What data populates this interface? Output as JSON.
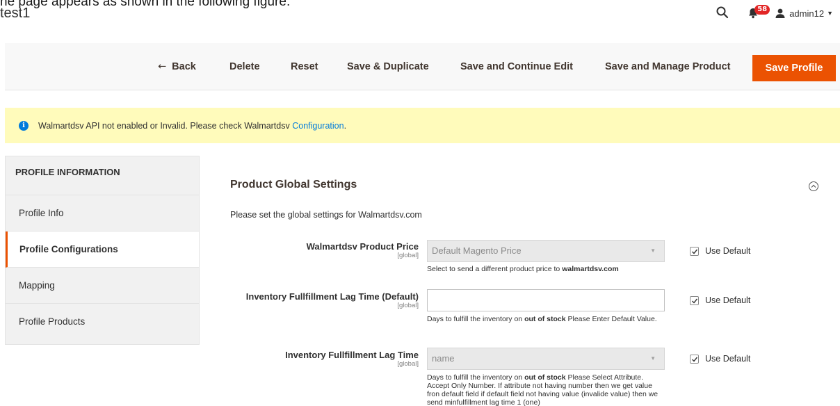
{
  "caption": "he page appears as shown in the following figure:",
  "page_title": "test1",
  "header": {
    "notification_count": "58",
    "user_name": "admin12"
  },
  "actions": {
    "back": "Back",
    "delete": "Delete",
    "reset": "Reset",
    "save_duplicate": "Save & Duplicate",
    "save_continue": "Save and Continue Edit",
    "save_manage": "Save and Manage Product",
    "save_profile": "Save Profile"
  },
  "notice": {
    "text": "Walmartdsv API not enabled or Invalid. Please check Walmartdsv ",
    "link": "Configuration",
    "suffix": "."
  },
  "sidebar": {
    "heading": "PROFILE INFORMATION",
    "items": [
      {
        "label": "Profile Info"
      },
      {
        "label": "Profile Configurations"
      },
      {
        "label": "Mapping"
      },
      {
        "label": "Profile Products"
      }
    ]
  },
  "section": {
    "title": "Product Global Settings",
    "description": "Please set the global settings for Walmartdsv.com"
  },
  "fields": [
    {
      "label": "Walmartdsv Product Price",
      "scope": "[global]",
      "value": "Default Magento Price",
      "note_before": "Select to send a different product price to ",
      "note_bold": "walmartdsv.com",
      "note_after": "",
      "use_default": "Use Default"
    },
    {
      "label": "Inventory Fullfillment Lag Time (Default)",
      "scope": "[global]",
      "value": "",
      "note_before": "Days to fulfill the inventory on ",
      "note_bold": "out of stock",
      "note_after": " Please Enter Default Value.",
      "use_default": "Use Default"
    },
    {
      "label": "Inventory Fullfillment Lag Time",
      "scope": "[global]",
      "value": "name",
      "note_before": "Days to fulfill the inventory on ",
      "note_bold": "out of stock",
      "note_after": " Please Select Attribute. Accept Only Number. If attribute not having number then we get value fron default field if default field not having value (invalide value) then we send minfulfillment lag time 1 (one)",
      "use_default": "Use Default"
    }
  ]
}
